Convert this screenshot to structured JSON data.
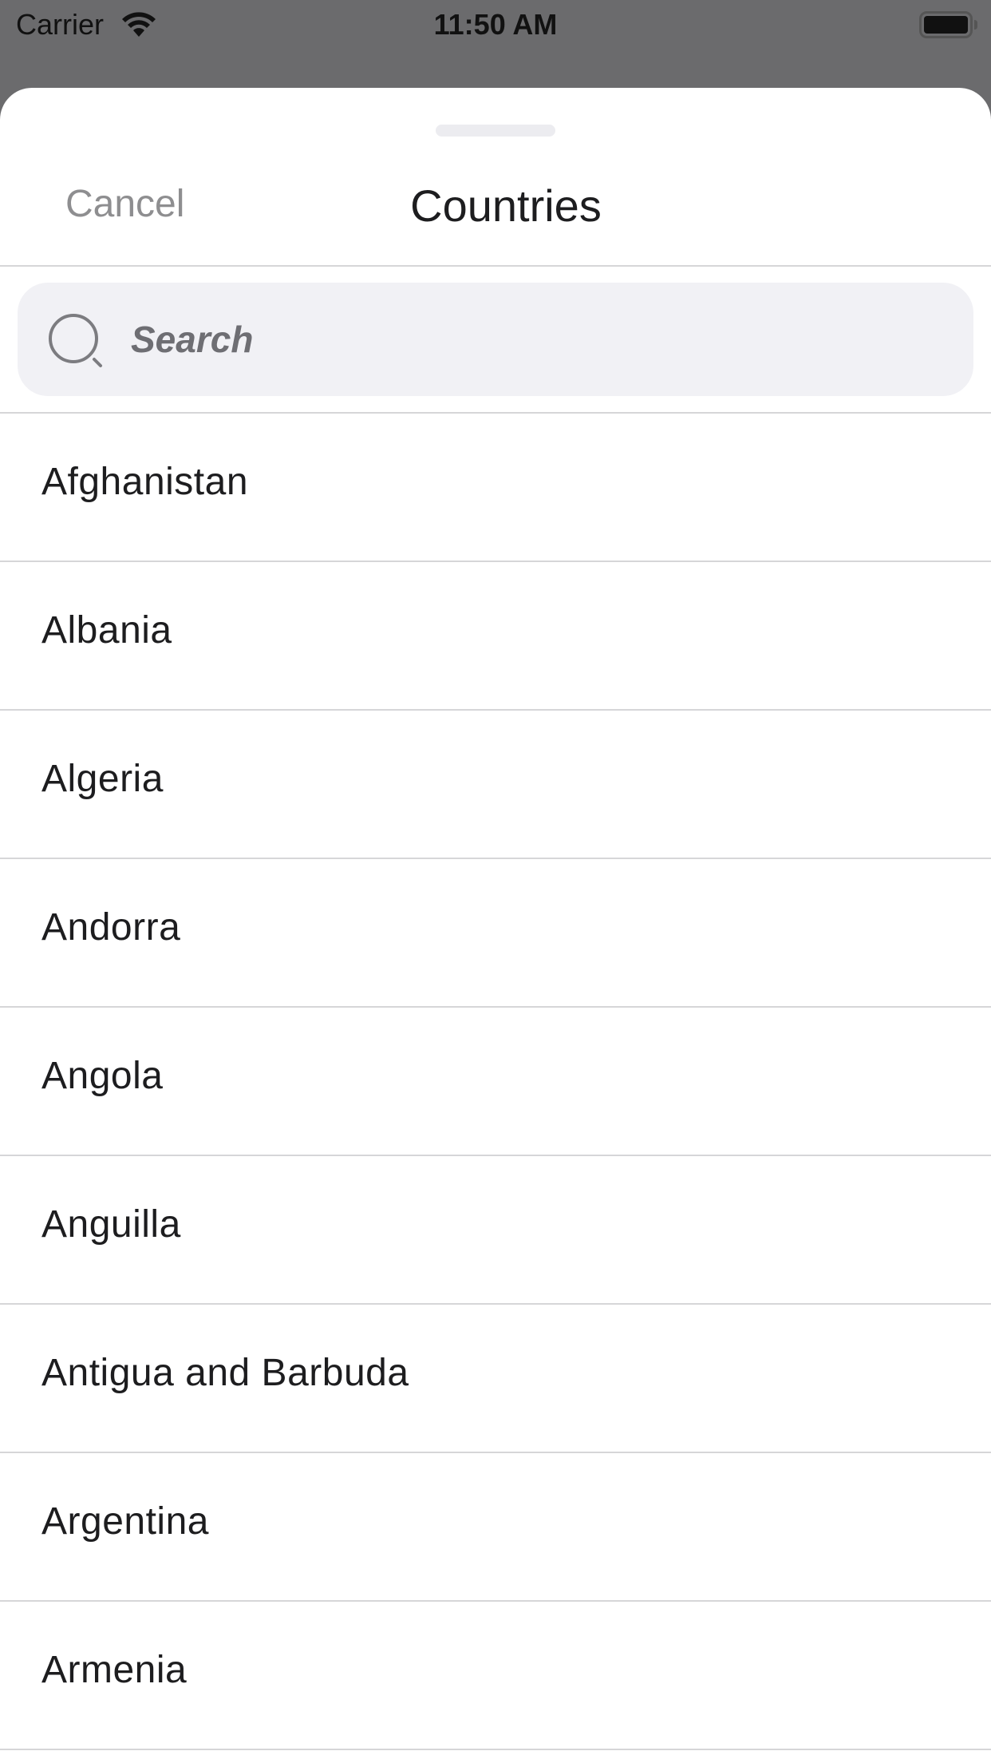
{
  "status_bar": {
    "carrier": "Carrier",
    "time": "11:50 AM",
    "wifi_icon": "wifi-icon",
    "battery_icon": "battery-full-icon"
  },
  "sheet": {
    "cancel_label": "Cancel",
    "title": "Countries"
  },
  "search": {
    "placeholder": "Search",
    "value": "",
    "icon": "search-icon"
  },
  "countries": [
    {
      "label": "Afghanistan"
    },
    {
      "label": "Albania"
    },
    {
      "label": "Algeria"
    },
    {
      "label": "Andorra"
    },
    {
      "label": "Angola"
    },
    {
      "label": "Anguilla"
    },
    {
      "label": "Antigua and Barbuda"
    },
    {
      "label": "Argentina"
    },
    {
      "label": "Armenia"
    }
  ],
  "colors": {
    "backdrop": "#6b6b6d",
    "sheet_background": "#ffffff",
    "search_field": "#f1f1f5",
    "cancel_text": "#8e8e90",
    "separator": "#d6d6d8"
  }
}
